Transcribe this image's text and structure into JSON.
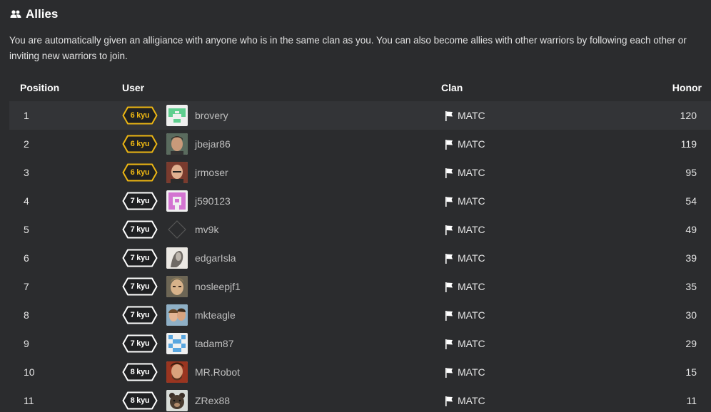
{
  "section": {
    "title": "Allies",
    "icon": "users-icon",
    "description": "You are automatically given an alligiance with anyone who is in the same clan as you. You can also become allies with other warriors by following each other or inviting new warriors to join."
  },
  "table": {
    "columns": [
      "Position",
      "User",
      "Clan",
      "Honor"
    ],
    "rows": [
      {
        "position": "1",
        "rank": "6 kyu",
        "rank_color": "yellow",
        "avatar": "identicon-green",
        "user": "brovery",
        "clan": "MATC",
        "honor": "120"
      },
      {
        "position": "2",
        "rank": "6 kyu",
        "rank_color": "yellow",
        "avatar": "photo-man-dark-hair",
        "user": "jbejar86",
        "clan": "MATC",
        "honor": "119"
      },
      {
        "position": "3",
        "rank": "6 kyu",
        "rank_color": "yellow",
        "avatar": "photo-man-bald",
        "user": "jrmoser",
        "clan": "MATC",
        "honor": "95"
      },
      {
        "position": "4",
        "rank": "7 kyu",
        "rank_color": "white",
        "avatar": "identicon-pink",
        "user": "j590123",
        "clan": "MATC",
        "honor": "54"
      },
      {
        "position": "5",
        "rank": "7 kyu",
        "rank_color": "white",
        "avatar": "diamond-placeholder",
        "user": "mv9k",
        "clan": "MATC",
        "honor": "49"
      },
      {
        "position": "6",
        "rank": "7 kyu",
        "rank_color": "white",
        "avatar": "photo-sketch",
        "user": "edgarIsla",
        "clan": "MATC",
        "honor": "39"
      },
      {
        "position": "7",
        "rank": "7 kyu",
        "rank_color": "white",
        "avatar": "photo-man-face",
        "user": "nosleepjf1",
        "clan": "MATC",
        "honor": "35"
      },
      {
        "position": "8",
        "rank": "7 kyu",
        "rank_color": "white",
        "avatar": "photo-couple",
        "user": "mkteagle",
        "clan": "MATC",
        "honor": "30"
      },
      {
        "position": "9",
        "rank": "7 kyu",
        "rank_color": "white",
        "avatar": "identicon-blue",
        "user": "tadam87",
        "clan": "MATC",
        "honor": "29"
      },
      {
        "position": "10",
        "rank": "8 kyu",
        "rank_color": "white",
        "avatar": "photo-man-beard",
        "user": "MR.Robot",
        "clan": "MATC",
        "honor": "15"
      },
      {
        "position": "11",
        "rank": "8 kyu",
        "rank_color": "white",
        "avatar": "photo-bear",
        "user": "ZRex88",
        "clan": "MATC",
        "honor": "11"
      }
    ]
  },
  "colors": {
    "background": "#2b2c2e",
    "highlight_row": "#333437",
    "rank_yellow": "#ecb613",
    "rank_white": "#ffffff"
  }
}
